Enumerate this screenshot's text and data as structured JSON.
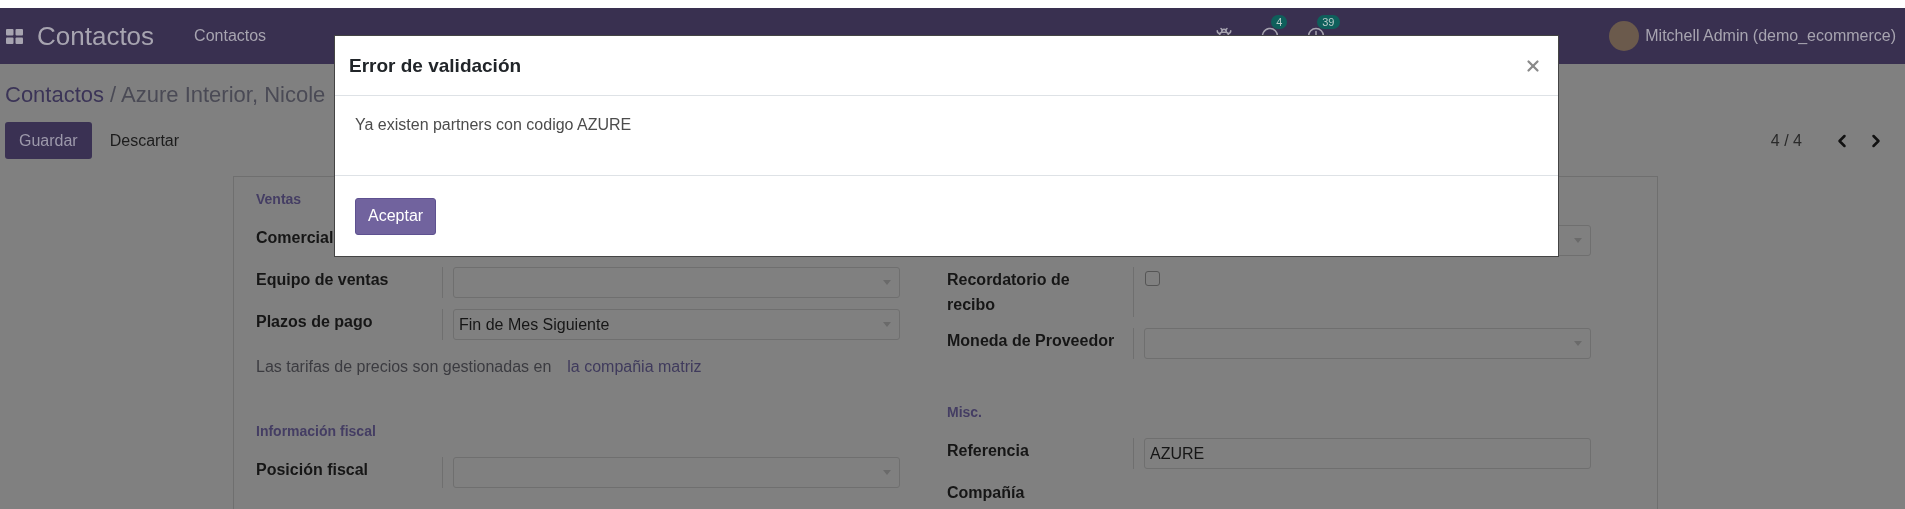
{
  "navbar": {
    "app_name": "Contactos",
    "menu": [
      "Contactos"
    ],
    "systray": [
      {
        "kind": "debug"
      },
      {
        "kind": "messages",
        "count": "4"
      },
      {
        "kind": "activities",
        "count": "39"
      }
    ],
    "user": "Mitchell Admin (demo_ecommerce)"
  },
  "breadcrumb": {
    "parent": "Contactos",
    "current": "/ Azure Interior, Nicole"
  },
  "actions": {
    "save": "Guardar",
    "discard": "Descartar"
  },
  "pager": {
    "value": "4 / 4"
  },
  "form": {
    "left": [
      {
        "kind": "heading",
        "text": "Ventas"
      },
      {
        "kind": "covered",
        "label": "Comercial"
      },
      {
        "kind": "select",
        "label": "Equipo de ventas"
      },
      {
        "kind": "select",
        "label": "Plazos de pago",
        "value": "Fin de Mes Siguiente"
      },
      {
        "kind": "note",
        "text": "Las tarifas de precios son gestionadas en",
        "link": "la compañia matriz"
      },
      {
        "kind": "heading",
        "text": "Información fiscal"
      },
      {
        "kind": "select",
        "label": "Posición fiscal"
      }
    ],
    "right": [
      {
        "kind": "select"
      },
      {
        "kind": "checkbox",
        "label": "Recordatorio de recibo",
        "checked": false
      },
      {
        "kind": "select",
        "label": "Moneda de Proveedor"
      },
      {
        "kind": "heading",
        "text": "Misc."
      },
      {
        "kind": "input",
        "label": "Referencia",
        "value": "AZURE"
      },
      {
        "kind": "covered",
        "label": "Compañía"
      }
    ]
  },
  "dialog": {
    "title": "Error de validación",
    "message": "Ya existen partners con codigo AZURE",
    "button": "Aceptar"
  }
}
